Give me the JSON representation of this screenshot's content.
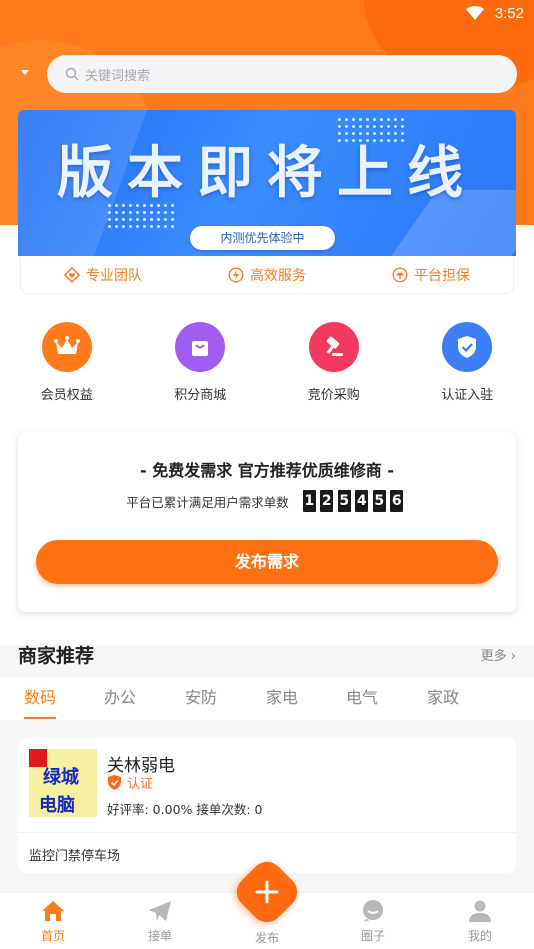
{
  "status_bar": {
    "time": "3:52"
  },
  "search": {
    "placeholder": "关键词搜索"
  },
  "banner": {
    "title": "版本即将上线",
    "pill": "内测优先体验中"
  },
  "features": [
    {
      "label": "专业团队",
      "icon": "heart-diamond-icon"
    },
    {
      "label": "高效服务",
      "icon": "lightning-icon"
    },
    {
      "label": "平台担保",
      "icon": "umbrella-icon"
    }
  ],
  "quick_entries": [
    {
      "label": "会员权益",
      "icon": "crown-icon",
      "color": "#ff7a1a"
    },
    {
      "label": "积分商城",
      "icon": "shopping-bag-icon",
      "color": "#a35cf0"
    },
    {
      "label": "竞价采购",
      "icon": "gavel-icon",
      "color": "#f33a5e"
    },
    {
      "label": "认证入驻",
      "icon": "shield-check-icon",
      "color": "#3d7df5"
    }
  ],
  "demand_card": {
    "headline": "- 免费发需求  官方推荐优质维修商 -",
    "stat_label": "平台已累计满足用户需求单数",
    "digits": [
      "1",
      "2",
      "5",
      "4",
      "5",
      "6"
    ],
    "button": "发布需求"
  },
  "merchants": {
    "title": "商家推荐",
    "more": "更多",
    "tabs": [
      "数码",
      "办公",
      "安防",
      "家电",
      "电气",
      "家政"
    ],
    "active_tab": "数码",
    "items": [
      {
        "logo_text_1": "绿城",
        "logo_text_2": "电脑",
        "name": "关林弱电",
        "badge": "认证",
        "rating_line": "好评率: 0.00%  接单次数: 0",
        "tags": "监控门禁停车场"
      }
    ]
  },
  "bottom_nav": [
    {
      "label": "首页",
      "icon": "home-icon",
      "active": true
    },
    {
      "label": "接单",
      "icon": "paper-plane-icon",
      "active": false
    },
    {
      "label": "发布",
      "icon": "plus-icon",
      "active": false
    },
    {
      "label": "圈子",
      "icon": "chat-bubble-icon",
      "active": false
    },
    {
      "label": "我的",
      "icon": "user-icon",
      "active": false
    }
  ],
  "colors": {
    "accent": "#ff7a1a",
    "banner_blue": "#2a78f6"
  }
}
